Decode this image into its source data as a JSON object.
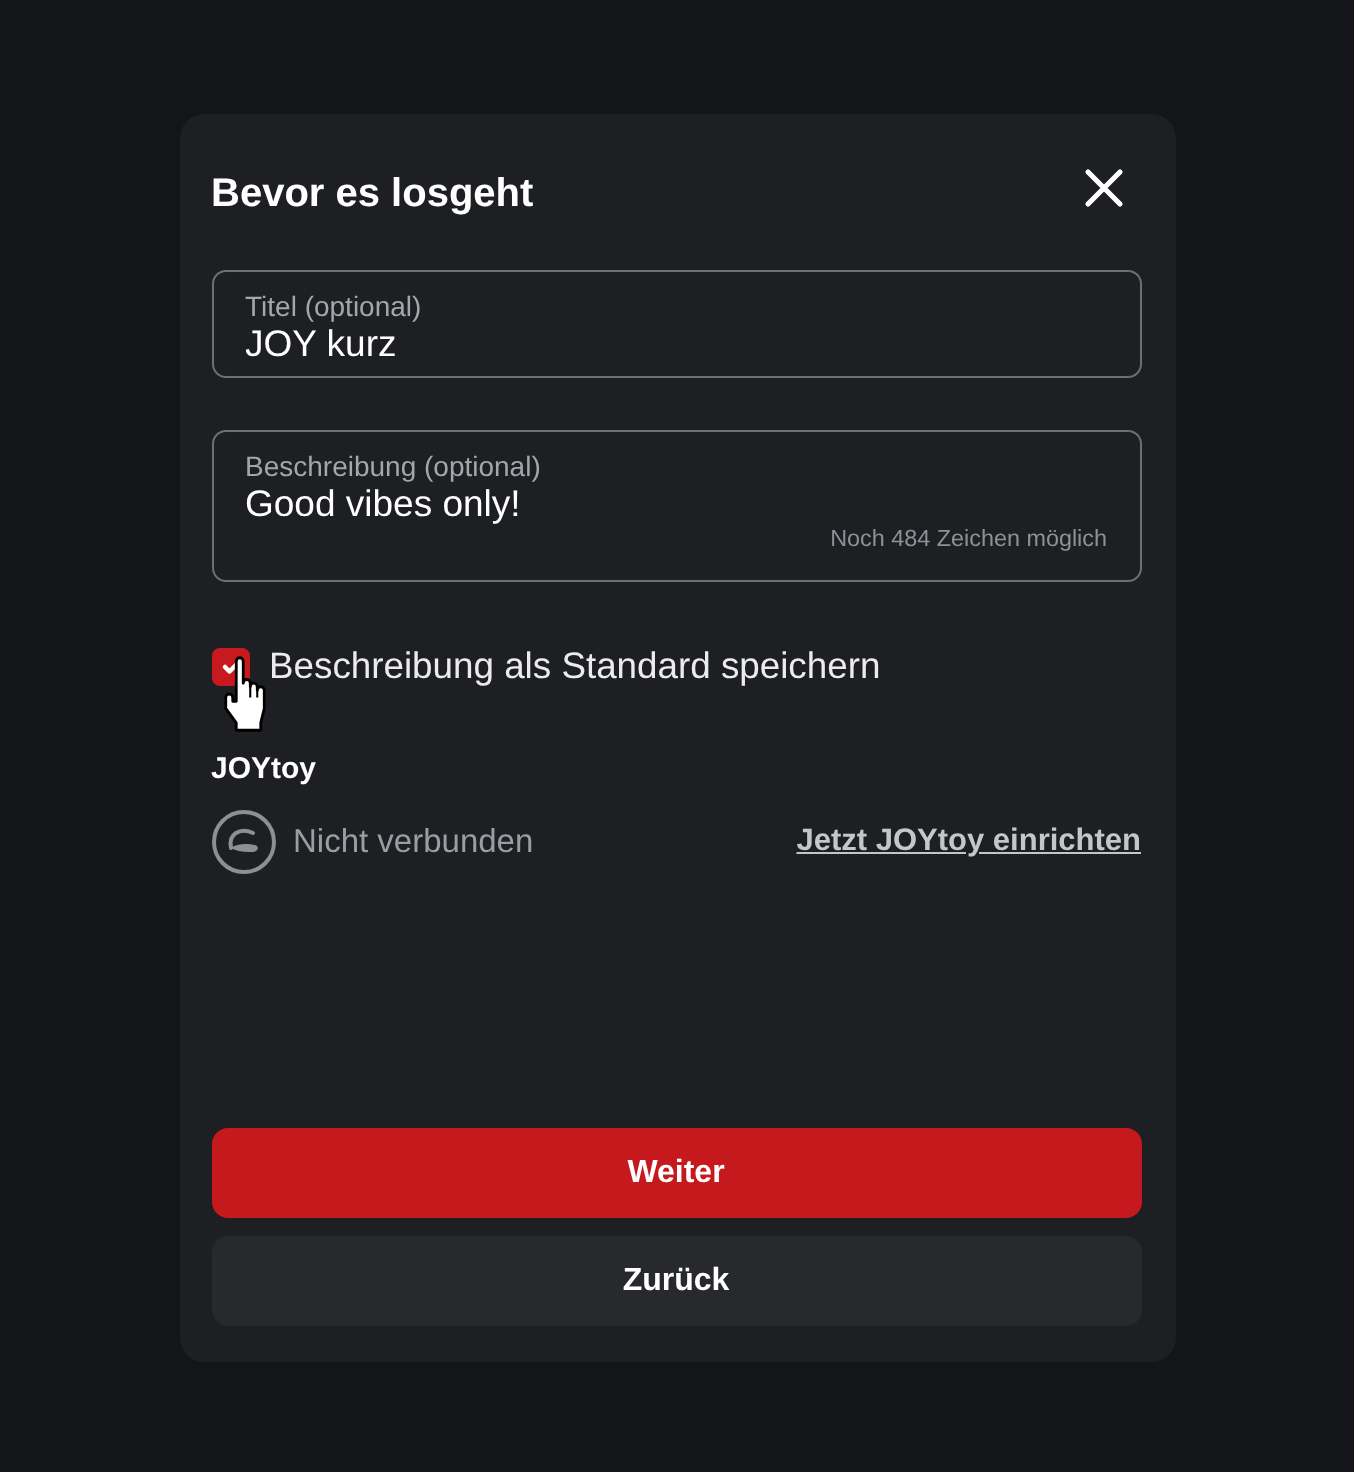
{
  "dialog": {
    "title": "Bevor es losgeht"
  },
  "fields": [
    {
      "kind": "input",
      "label": "Titel (optional)",
      "value": "JOY kurz"
    },
    {
      "kind": "textarea",
      "label": "Beschreibung (optional)",
      "value": "Good vibes only!",
      "counter": "Noch 484 Zeichen möglich"
    }
  ],
  "save_default": {
    "label": "Beschreibung als Standard speichern",
    "checked": true
  },
  "device": {
    "heading": "JOYtoy",
    "status": "Nicht verbunden",
    "link": "Jetzt JOYtoy einrichten"
  },
  "buttons": [
    {
      "kind": "primary",
      "label": "Weiter"
    },
    {
      "kind": "secondary",
      "label": "Zurück"
    }
  ]
}
